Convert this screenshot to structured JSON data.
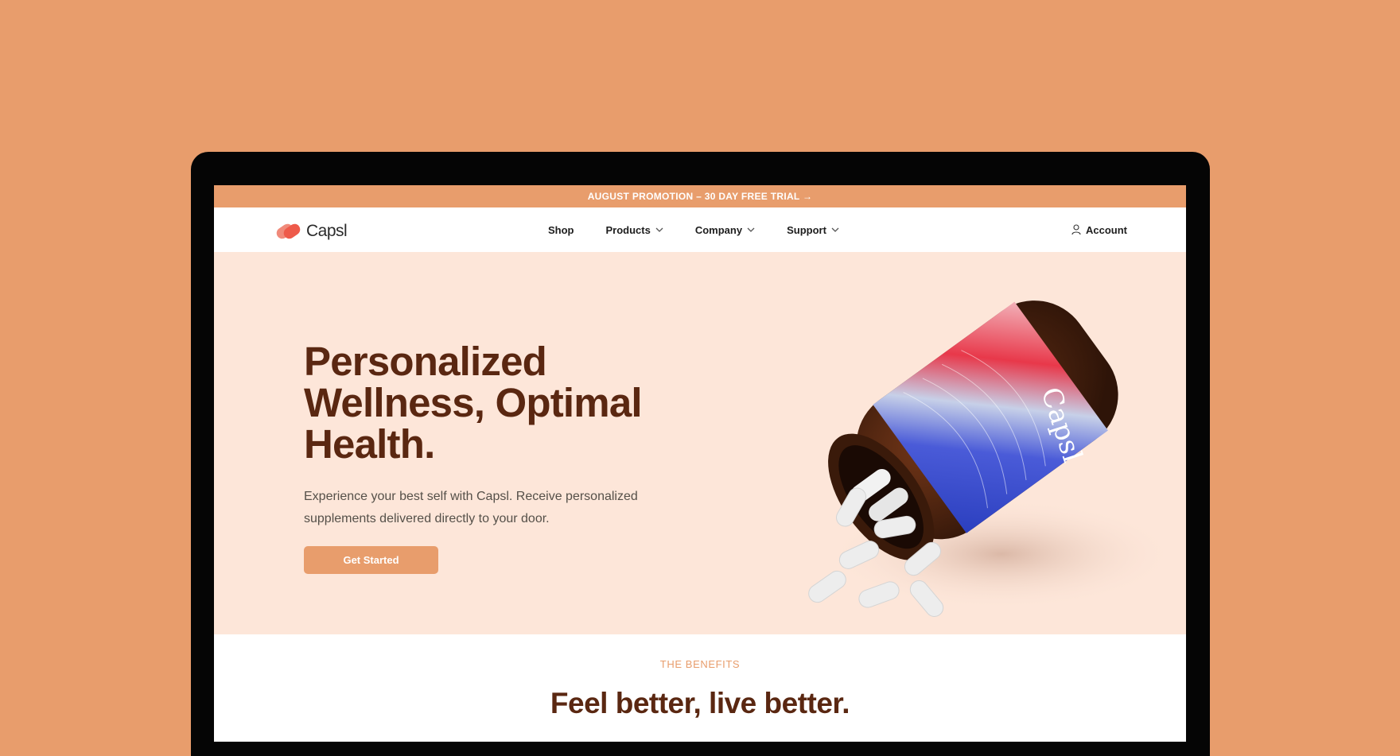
{
  "promo": {
    "text": "AUGUST PROMOTION – 30 DAY FREE TRIAL →"
  },
  "brand": {
    "name": "Capsl",
    "accent": "#E89D6C",
    "dark": "#5A2711",
    "hero_bg": "#FDE6D9"
  },
  "nav": {
    "items": [
      {
        "label": "Shop",
        "dropdown": false
      },
      {
        "label": "Products",
        "dropdown": true
      },
      {
        "label": "Company",
        "dropdown": true
      },
      {
        "label": "Support",
        "dropdown": true
      }
    ],
    "account_label": "Account"
  },
  "hero": {
    "title_lines": [
      "Personalized",
      "Wellness, Optimal",
      "Health."
    ],
    "subtitle": "Experience your best self with Capsl. Receive personalized supplements delivered directly to your door.",
    "cta_label": "Get Started",
    "bottle_label": "Capsl"
  },
  "benefits": {
    "eyebrow": "THE BENEFITS",
    "title": "Feel better, live better."
  }
}
